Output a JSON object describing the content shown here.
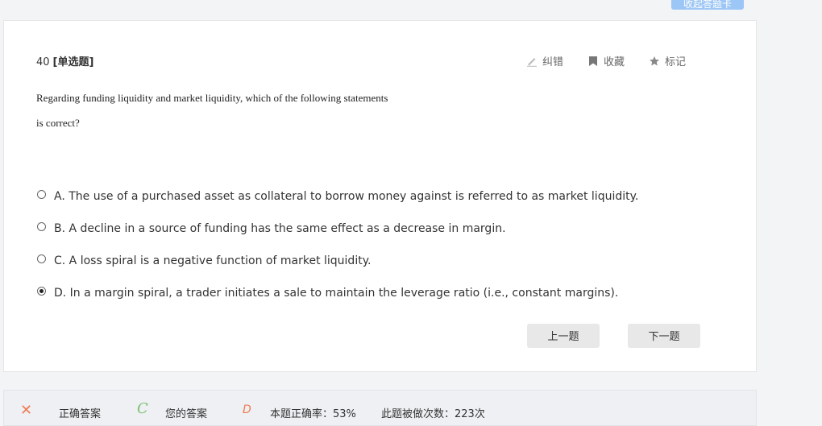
{
  "top_button": {
    "label": "收起答题卡"
  },
  "question": {
    "number": "40",
    "type": "[单选题]",
    "stem_line1": "Regarding funding liquidity and market liquidity, which of the following statements",
    "stem_line2": "is correct?"
  },
  "actions": {
    "correct_label": "纠错",
    "favorite_label": "收藏",
    "mark_label": "标记"
  },
  "options": [
    {
      "label": "A. The use of a purchased asset as collateral to borrow money against is referred to as market liquidity.",
      "selected": false
    },
    {
      "label": "B. A decline in a source of funding has the same effect as a decrease in margin.",
      "selected": false
    },
    {
      "label": "C. A loss spiral is a negative function of market liquidity.",
      "selected": false
    },
    {
      "label": "D. In a margin spiral, a trader initiates a sale to maintain the leverage ratio (i.e., constant margins).",
      "selected": true
    }
  ],
  "nav": {
    "prev_label": "上一题",
    "next_label": "下一题"
  },
  "footer": {
    "x_mark": "✕",
    "correct_answer_label": "正确答案",
    "correct_answer_value": "C",
    "your_answer_label": "您的答案",
    "your_answer_value": "D",
    "accuracy_text": "本题正确率：53%",
    "count_text": "此题被做次数：223次"
  },
  "colors": {
    "accent_red": "#f07a52",
    "accent_green": "#7cc26f",
    "button_blue": "#9cc6f5"
  }
}
